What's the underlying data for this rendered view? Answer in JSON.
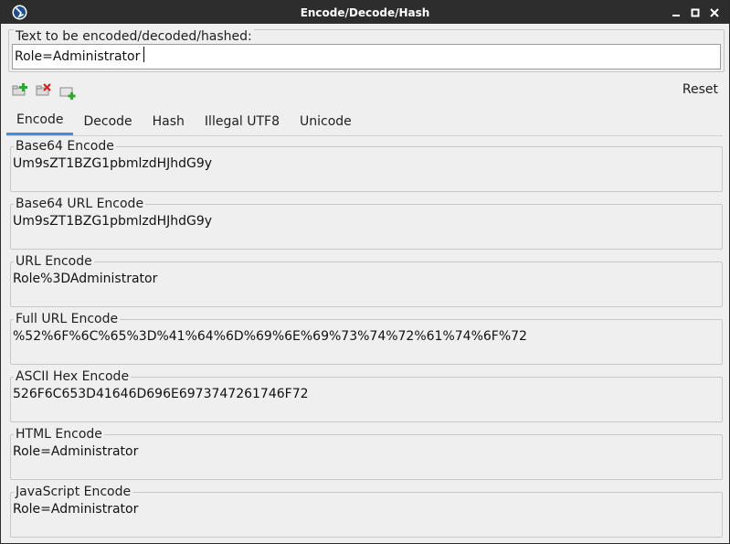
{
  "window": {
    "title": "Encode/Decode/Hash"
  },
  "input": {
    "legend": "Text to be encoded/decoded/hashed:",
    "value": "Role=Administrator"
  },
  "toolbar": {
    "add_icon": "add-tab-icon",
    "remove_icon": "remove-tab-icon",
    "new_icon": "new-tab-icon",
    "reset_label": "Reset"
  },
  "tabs": [
    {
      "label": "Encode",
      "active": true
    },
    {
      "label": "Decode",
      "active": false
    },
    {
      "label": "Hash",
      "active": false
    },
    {
      "label": "Illegal UTF8",
      "active": false
    },
    {
      "label": "Unicode",
      "active": false
    }
  ],
  "encodings": [
    {
      "label": "Base64 Encode",
      "value": "Um9sZT1BZG1pbmlzdHJhdG9y"
    },
    {
      "label": "Base64 URL Encode",
      "value": "Um9sZT1BZG1pbmlzdHJhdG9y"
    },
    {
      "label": "URL Encode",
      "value": "Role%3DAdministrator"
    },
    {
      "label": "Full URL Encode",
      "value": "%52%6F%6C%65%3D%41%64%6D%69%6E%69%73%74%72%61%74%6F%72"
    },
    {
      "label": "ASCII Hex Encode",
      "value": "526F6C653D41646D696E6973747261746F72"
    },
    {
      "label": "HTML Encode",
      "value": "Role=Administrator"
    },
    {
      "label": "JavaScript Encode",
      "value": "Role=Administrator"
    }
  ],
  "colors": {
    "titlebar": "#2d2d2d",
    "tab_accent": "#3d8ee6",
    "background": "#efefef"
  }
}
